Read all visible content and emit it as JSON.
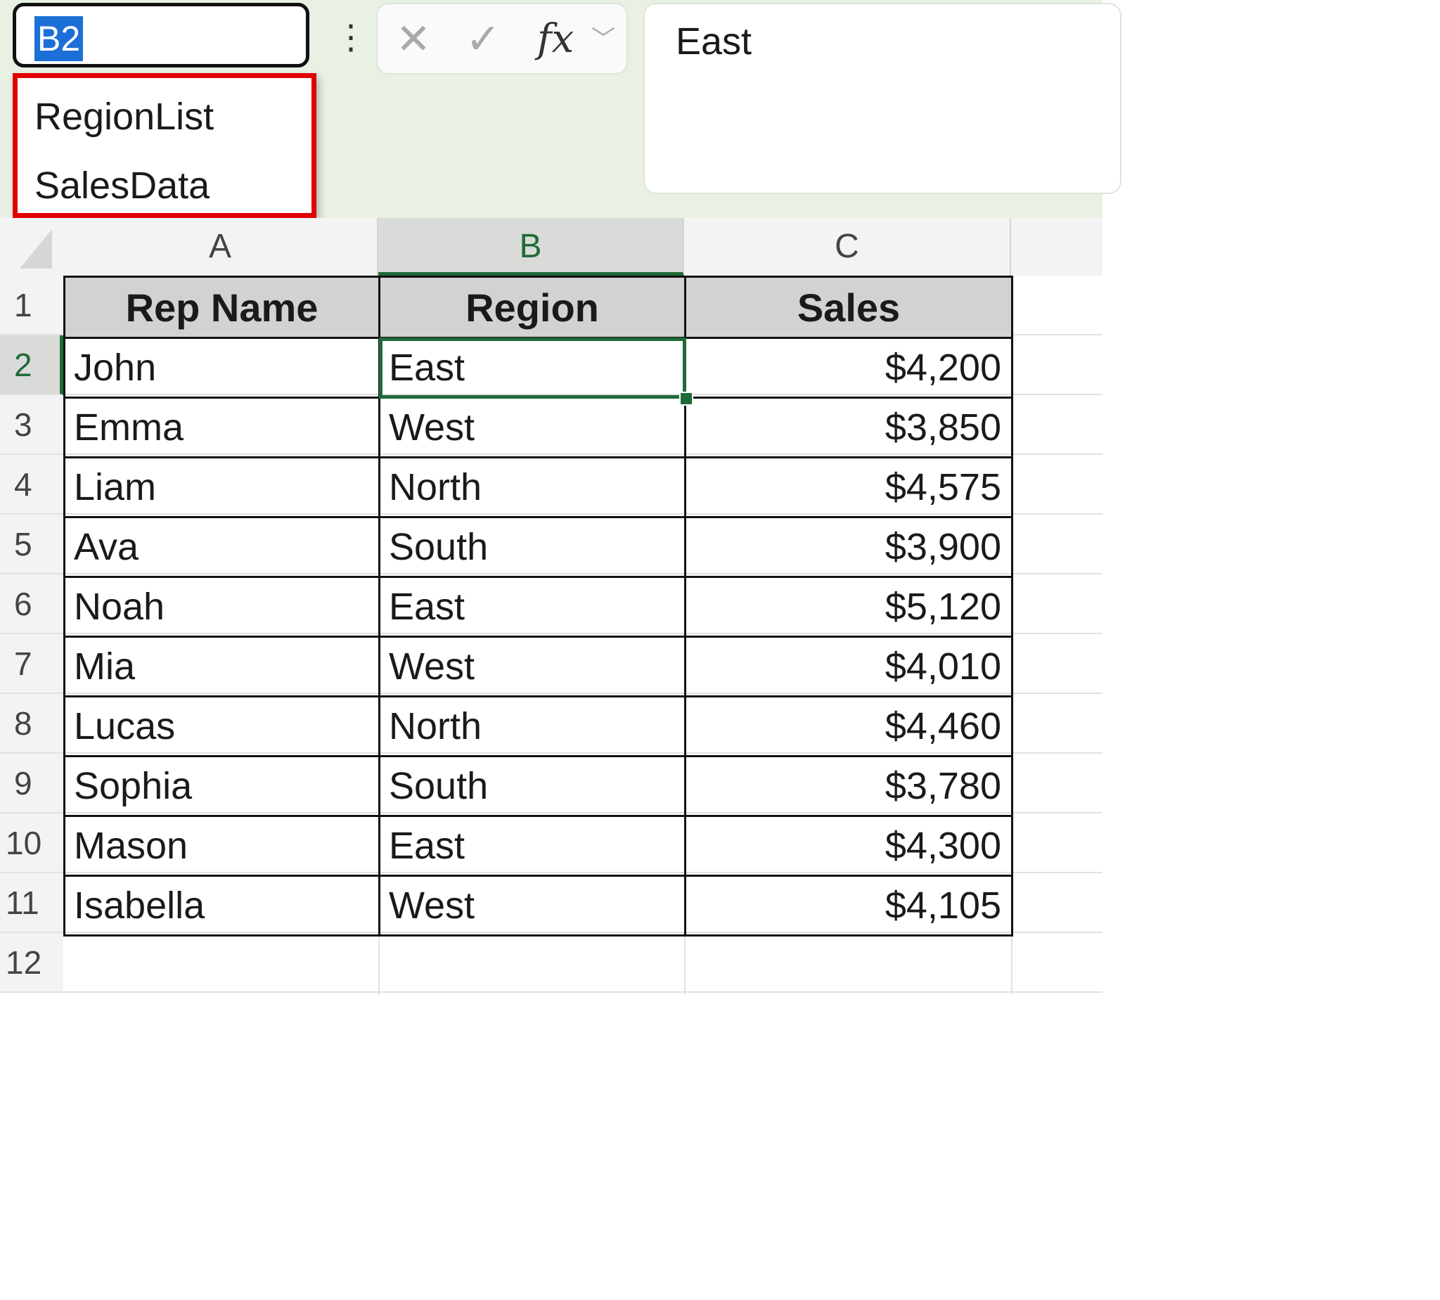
{
  "name_box": {
    "value": "B2"
  },
  "name_box_dropdown": {
    "items": [
      "RegionList",
      "SalesData"
    ]
  },
  "formula_bar": {
    "fx_label": "fx",
    "content": "East"
  },
  "column_headers": [
    "A",
    "B",
    "C"
  ],
  "row_headers": [
    "1",
    "2",
    "3",
    "4",
    "5",
    "6",
    "7",
    "8",
    "9",
    "10",
    "11",
    "12"
  ],
  "table": {
    "headers": [
      "Rep Name",
      "Region",
      "Sales"
    ],
    "rows": [
      [
        "John",
        "East",
        "$4,200"
      ],
      [
        "Emma",
        "West",
        "$3,850"
      ],
      [
        "Liam",
        "North",
        "$4,575"
      ],
      [
        "Ava",
        "South",
        "$3,900"
      ],
      [
        "Noah",
        "East",
        "$5,120"
      ],
      [
        "Mia",
        "West",
        "$4,010"
      ],
      [
        "Lucas",
        "North",
        "$4,460"
      ],
      [
        "Sophia",
        "South",
        "$3,780"
      ],
      [
        "Mason",
        "East",
        "$4,300"
      ],
      [
        "Isabella",
        "West",
        "$4,105"
      ]
    ]
  },
  "selected_cell": "B2",
  "colors": {
    "selection": "#1f6b37",
    "highlight_box": "#e00000",
    "name_box_selection": "#1d6fd8"
  }
}
